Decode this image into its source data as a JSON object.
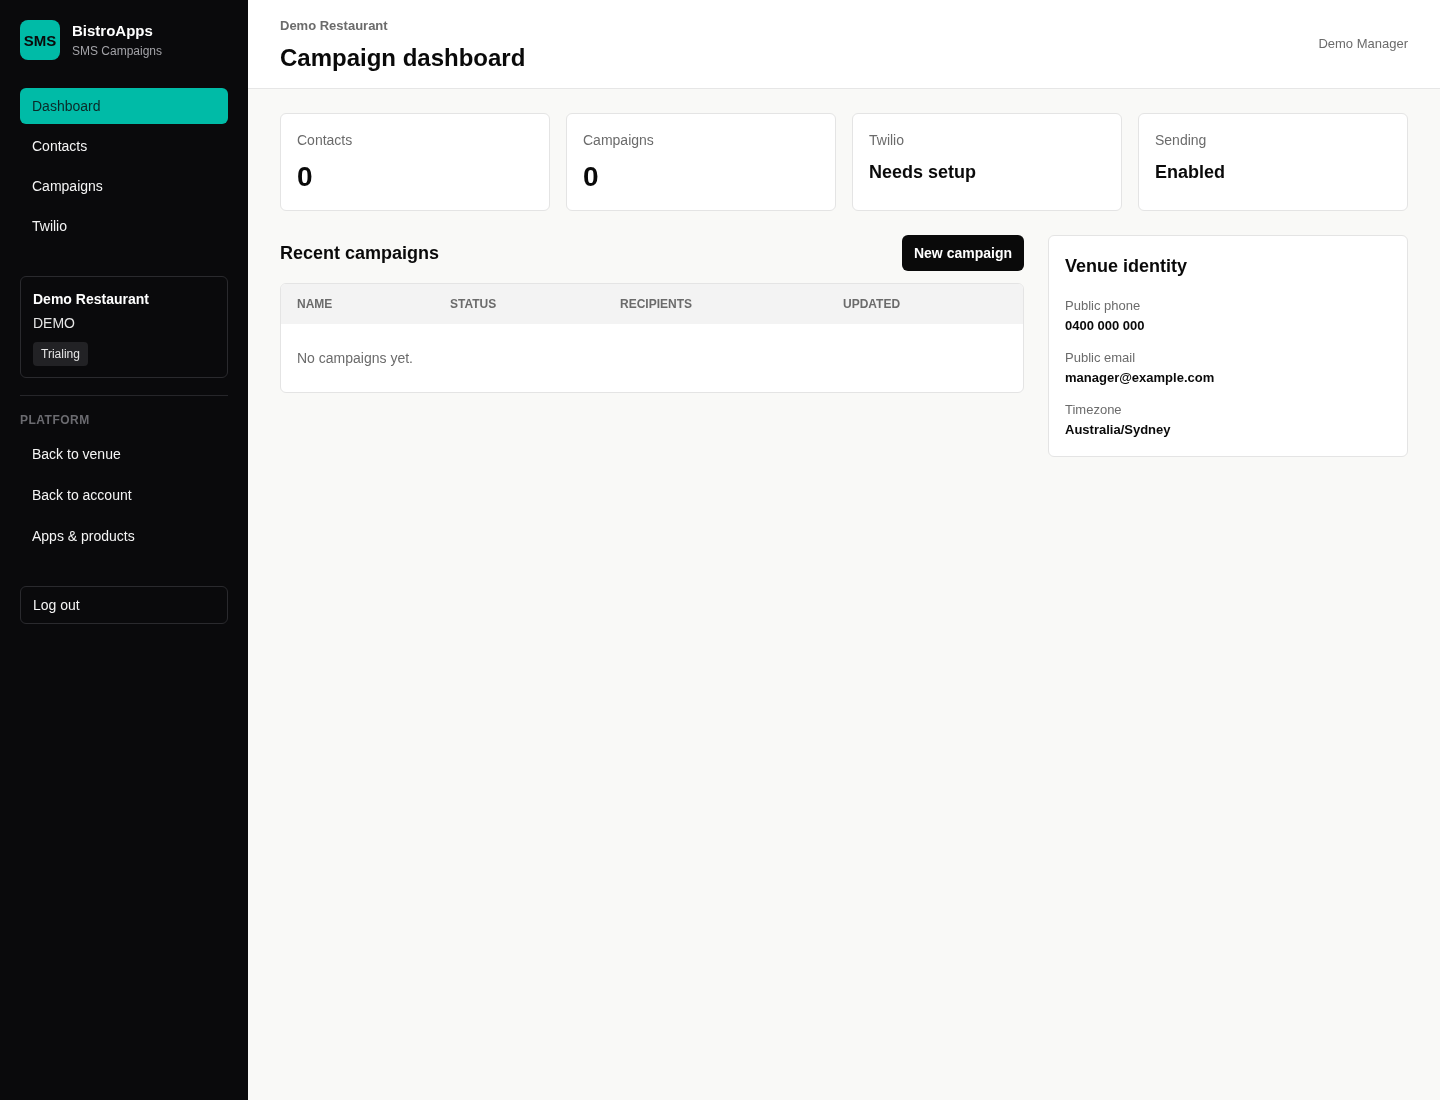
{
  "sidebar": {
    "logo": {
      "mark": "SMS",
      "title": "BistroApps",
      "subtitle": "SMS Campaigns"
    },
    "nav": [
      {
        "label": "Dashboard",
        "selected": true
      },
      {
        "label": "Contacts",
        "selected": false
      },
      {
        "label": "Campaigns",
        "selected": false
      },
      {
        "label": "Twilio",
        "selected": false
      }
    ],
    "venue": {
      "name": "Demo Restaurant",
      "code": "DEMO",
      "badge": "Trialing"
    },
    "platform": {
      "heading": "PLATFORM",
      "links": [
        "Back to venue",
        "Back to account",
        "Apps & products"
      ]
    },
    "logout": "Log out"
  },
  "header": {
    "breadcrumb": "Demo Restaurant",
    "title": "Campaign dashboard",
    "user": "Demo Manager"
  },
  "stats": [
    {
      "label": "Contacts",
      "value": "0",
      "kind": "count"
    },
    {
      "label": "Campaigns",
      "value": "0",
      "kind": "count"
    },
    {
      "label": "Twilio",
      "value": "Needs setup",
      "kind": "status"
    },
    {
      "label": "Sending",
      "value": "Enabled",
      "kind": "status"
    }
  ],
  "recent_campaigns": {
    "title": "Recent campaigns",
    "button": "New campaign",
    "table": {
      "columns": [
        "NAME",
        "STATUS",
        "RECIPIENTS",
        "UPDATED"
      ],
      "empty_message": "No campaigns yet."
    }
  },
  "venue_identity": {
    "title": "Venue identity",
    "fields": [
      {
        "label": "Public phone",
        "value": "0400 000 000"
      },
      {
        "label": "Public email",
        "value": "manager@example.com"
      },
      {
        "label": "Timezone",
        "value": "Australia/Sydney"
      }
    ]
  }
}
